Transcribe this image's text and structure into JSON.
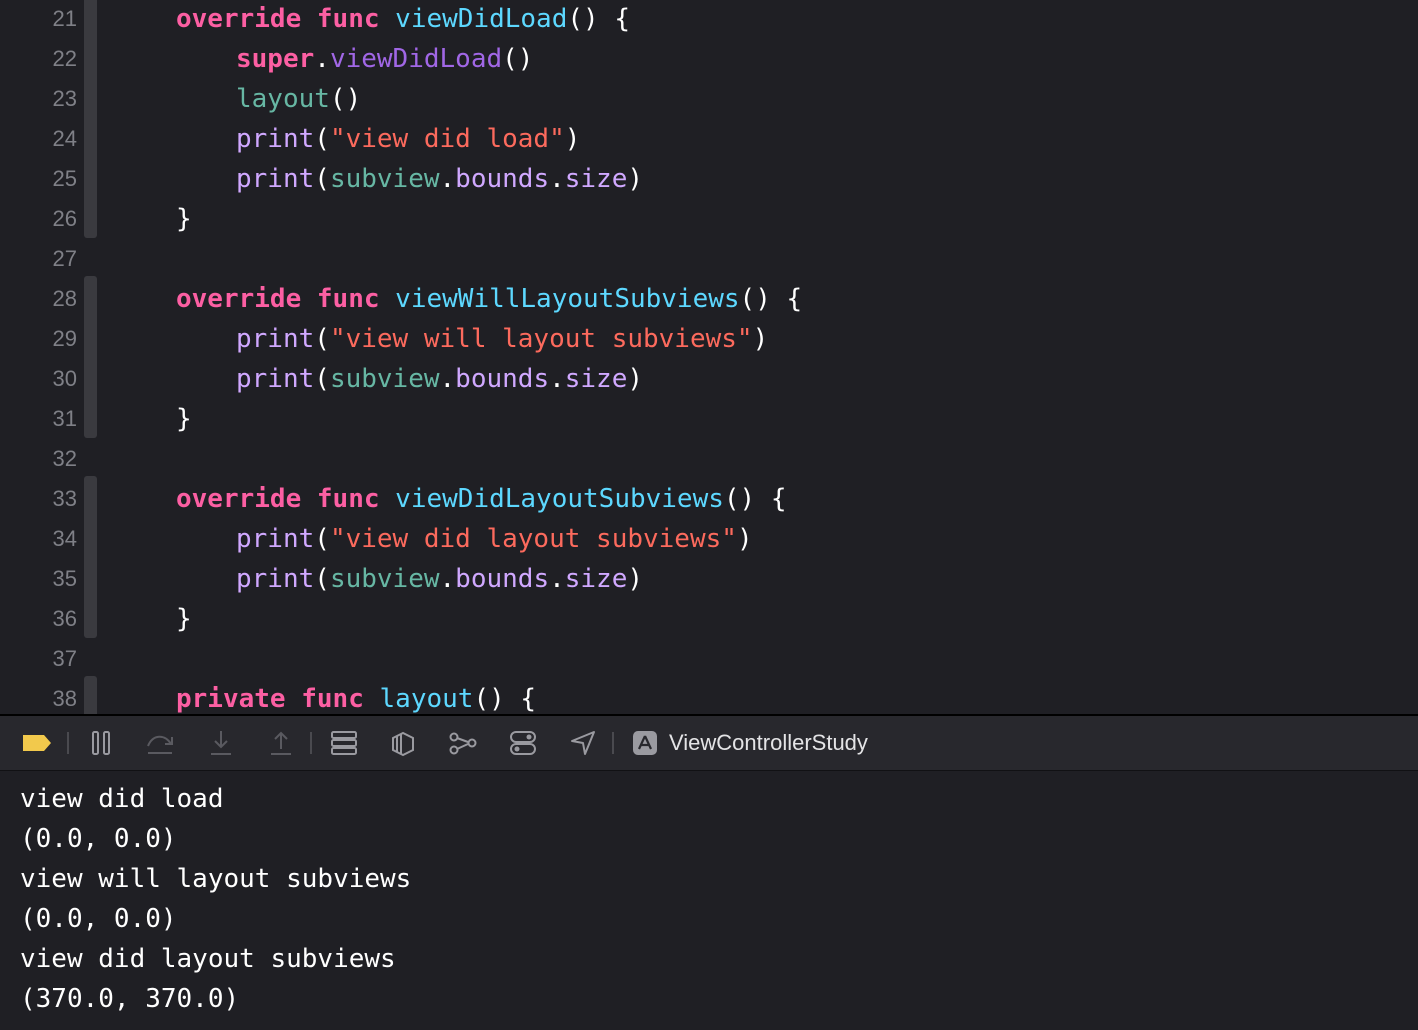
{
  "editor": {
    "lines": [
      {
        "num": "21",
        "indent": 2,
        "tokens": [
          {
            "t": "override",
            "c": "kw"
          },
          {
            "t": " ",
            "c": "plain"
          },
          {
            "t": "func",
            "c": "kw"
          },
          {
            "t": " ",
            "c": "plain"
          },
          {
            "t": "viewDidLoad",
            "c": "fn"
          },
          {
            "t": "() {",
            "c": "plain"
          }
        ]
      },
      {
        "num": "22",
        "indent": 3,
        "tokens": [
          {
            "t": "super",
            "c": "kw"
          },
          {
            "t": ".",
            "c": "plain"
          },
          {
            "t": "viewDidLoad",
            "c": "call"
          },
          {
            "t": "()",
            "c": "plain"
          }
        ]
      },
      {
        "num": "23",
        "indent": 3,
        "tokens": [
          {
            "t": "layout",
            "c": "local"
          },
          {
            "t": "()",
            "c": "plain"
          }
        ]
      },
      {
        "num": "24",
        "indent": 3,
        "tokens": [
          {
            "t": "print",
            "c": "sys"
          },
          {
            "t": "(",
            "c": "plain"
          },
          {
            "t": "\"view did load\"",
            "c": "str"
          },
          {
            "t": ")",
            "c": "plain"
          }
        ]
      },
      {
        "num": "25",
        "indent": 3,
        "tokens": [
          {
            "t": "print",
            "c": "sys"
          },
          {
            "t": "(",
            "c": "plain"
          },
          {
            "t": "subview",
            "c": "local"
          },
          {
            "t": ".",
            "c": "plain"
          },
          {
            "t": "bounds",
            "c": "sys"
          },
          {
            "t": ".",
            "c": "plain"
          },
          {
            "t": "size",
            "c": "sys"
          },
          {
            "t": ")",
            "c": "plain"
          }
        ]
      },
      {
        "num": "26",
        "indent": 2,
        "tokens": [
          {
            "t": "}",
            "c": "plain"
          }
        ]
      },
      {
        "num": "27",
        "indent": 0,
        "tokens": []
      },
      {
        "num": "28",
        "indent": 2,
        "tokens": [
          {
            "t": "override",
            "c": "kw"
          },
          {
            "t": " ",
            "c": "plain"
          },
          {
            "t": "func",
            "c": "kw"
          },
          {
            "t": " ",
            "c": "plain"
          },
          {
            "t": "viewWillLayoutSubviews",
            "c": "fn"
          },
          {
            "t": "() {",
            "c": "plain"
          }
        ]
      },
      {
        "num": "29",
        "indent": 3,
        "tokens": [
          {
            "t": "print",
            "c": "sys"
          },
          {
            "t": "(",
            "c": "plain"
          },
          {
            "t": "\"view will layout subviews\"",
            "c": "str"
          },
          {
            "t": ")",
            "c": "plain"
          }
        ]
      },
      {
        "num": "30",
        "indent": 3,
        "tokens": [
          {
            "t": "print",
            "c": "sys"
          },
          {
            "t": "(",
            "c": "plain"
          },
          {
            "t": "subview",
            "c": "local"
          },
          {
            "t": ".",
            "c": "plain"
          },
          {
            "t": "bounds",
            "c": "sys"
          },
          {
            "t": ".",
            "c": "plain"
          },
          {
            "t": "size",
            "c": "sys"
          },
          {
            "t": ")",
            "c": "plain"
          }
        ]
      },
      {
        "num": "31",
        "indent": 2,
        "tokens": [
          {
            "t": "}",
            "c": "plain"
          }
        ]
      },
      {
        "num": "32",
        "indent": 0,
        "tokens": []
      },
      {
        "num": "33",
        "indent": 2,
        "tokens": [
          {
            "t": "override",
            "c": "kw"
          },
          {
            "t": " ",
            "c": "plain"
          },
          {
            "t": "func",
            "c": "kw"
          },
          {
            "t": " ",
            "c": "plain"
          },
          {
            "t": "viewDidLayoutSubviews",
            "c": "fn"
          },
          {
            "t": "() {",
            "c": "plain"
          }
        ]
      },
      {
        "num": "34",
        "indent": 3,
        "tokens": [
          {
            "t": "print",
            "c": "sys"
          },
          {
            "t": "(",
            "c": "plain"
          },
          {
            "t": "\"view did layout subviews\"",
            "c": "str"
          },
          {
            "t": ")",
            "c": "plain"
          }
        ]
      },
      {
        "num": "35",
        "indent": 3,
        "tokens": [
          {
            "t": "print",
            "c": "sys"
          },
          {
            "t": "(",
            "c": "plain"
          },
          {
            "t": "subview",
            "c": "local"
          },
          {
            "t": ".",
            "c": "plain"
          },
          {
            "t": "bounds",
            "c": "sys"
          },
          {
            "t": ".",
            "c": "plain"
          },
          {
            "t": "size",
            "c": "sys"
          },
          {
            "t": ")",
            "c": "plain"
          }
        ]
      },
      {
        "num": "36",
        "indent": 2,
        "tokens": [
          {
            "t": "}",
            "c": "plain"
          }
        ]
      },
      {
        "num": "37",
        "indent": 0,
        "tokens": []
      },
      {
        "num": "38",
        "indent": 2,
        "tokens": [
          {
            "t": "private",
            "c": "kw"
          },
          {
            "t": " ",
            "c": "plain"
          },
          {
            "t": "func",
            "c": "kw"
          },
          {
            "t": " ",
            "c": "plain"
          },
          {
            "t": "layout",
            "c": "fn"
          },
          {
            "t": "() {",
            "c": "plain"
          }
        ]
      }
    ]
  },
  "debug_bar": {
    "icons": [
      "breakpoint-toggle-icon",
      "pause-icon",
      "step-over-icon",
      "step-into-icon",
      "step-out-icon",
      "view-hierarchy-icon",
      "memory-graph-icon",
      "environment-overrides-icon",
      "simulate-location-icon",
      "location-icon",
      "app-target-icon"
    ],
    "target_name": "ViewControllerStudy"
  },
  "console": {
    "lines": [
      "view did load",
      "(0.0, 0.0)",
      "view will layout subviews",
      "(0.0, 0.0)",
      "view did layout subviews",
      "(370.0, 370.0)"
    ]
  },
  "colors": {
    "keyword": "#fc5fa3",
    "function_decl": "#5dd8ff",
    "method_call": "#a167e6",
    "system_member": "#d0a8ff",
    "local_member": "#67b7a4",
    "string": "#fc6a5d",
    "breakpoint": "#f2c94c"
  }
}
